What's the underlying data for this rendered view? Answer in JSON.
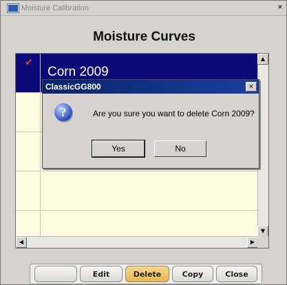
{
  "window": {
    "title": "Moisture Calibration",
    "close": "×"
  },
  "heading": "Moisture Curves",
  "list": {
    "items": [
      {
        "label": "Corn 2009",
        "checked": true,
        "selected": true
      },
      {
        "label": ""
      },
      {
        "label": ""
      },
      {
        "label": ""
      },
      {
        "label": ""
      }
    ]
  },
  "toolbar": {
    "blank_label": "",
    "edit_label": "Edit",
    "delete_label": "Delete",
    "copy_label": "Copy",
    "close_label": "Close"
  },
  "dialog": {
    "title": "ClassicGG800",
    "close": "×",
    "icon": "question-icon",
    "message": "Are you sure you want to delete Corn 2009?",
    "yes_label": "Yes",
    "no_label": "No"
  },
  "colors": {
    "selected_row": "#0a0a7a",
    "list_background": "#fffbe0",
    "delete_button": "#e7b84a",
    "dialog_title": "#0a246a"
  }
}
